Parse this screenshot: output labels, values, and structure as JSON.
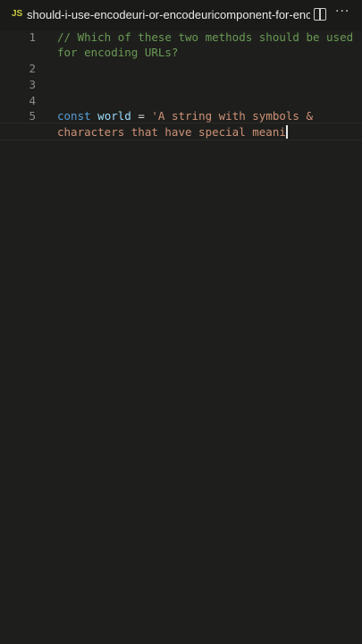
{
  "tab": {
    "language_badge": "JS",
    "title": "should-i-use-encodeuri-or-encodeuricomponent-for-encoding-urls.js",
    "split_icon": "split-editor-icon",
    "more_icon": "more-actions-icon",
    "more_glyph": "···"
  },
  "editor": {
    "line_numbers": [
      "1",
      "2",
      "3",
      "4",
      "5"
    ],
    "lines": {
      "l1a": "// Which of these two methods should be used",
      "l1b": "for encoding URLs?",
      "l5_kw": "const",
      "l5_var": "world",
      "l5_op": " = ",
      "l5_str_a": "'A string with symbols &",
      "l5_str_b": "characters that have special meani"
    }
  },
  "colors": {
    "background": "#1e1f1c",
    "comment": "#6a9955",
    "keyword": "#569cd6",
    "variable": "#9cdcfe",
    "string": "#ce9178"
  }
}
